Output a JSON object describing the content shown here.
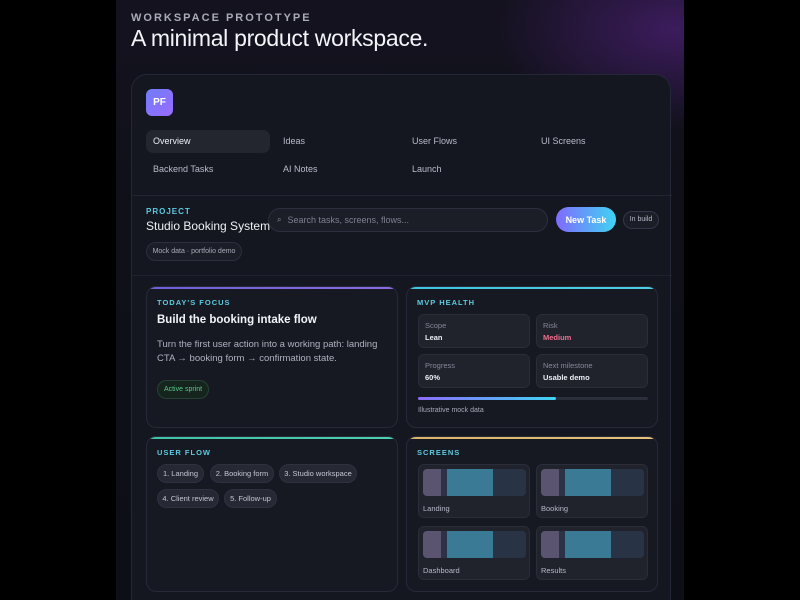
{
  "header": {
    "eyebrow": "WORKSPACE PROTOTYPE",
    "title": "A minimal product workspace."
  },
  "logo": {
    "initials": "PF"
  },
  "nav": {
    "items": [
      {
        "label": "Overview",
        "active": true
      },
      {
        "label": "Ideas"
      },
      {
        "label": "User Flows"
      },
      {
        "label": "UI Screens"
      },
      {
        "label": "Backend Tasks"
      },
      {
        "label": "AI Notes"
      },
      {
        "label": "Launch"
      }
    ]
  },
  "project": {
    "label": "PROJECT",
    "name": "Studio Booking System",
    "mock_chip": "Mock data · portfolio demo",
    "status_badge": "In build"
  },
  "search": {
    "placeholder": "Search tasks, screens, flows..."
  },
  "toolbar": {
    "new_task_label": "New Task"
  },
  "focus": {
    "label": "TODAY'S FOCUS",
    "title": "Build the booking intake flow",
    "description": "Turn the first user action into a working path: landing CTA → booking form → confirmation state.",
    "chip": "Active sprint"
  },
  "health": {
    "label": "MVP HEALTH",
    "metrics": [
      {
        "label": "Scope",
        "value": "Lean"
      },
      {
        "label": "Risk",
        "value": "Medium"
      },
      {
        "label": "Progress",
        "value": "60%"
      },
      {
        "label": "Next milestone",
        "value": "Usable demo"
      }
    ],
    "progress_fraction": 0.6,
    "note": "Illustrative mock data"
  },
  "flow": {
    "label": "USER FLOW",
    "steps": [
      "1. Landing",
      "2. Booking form",
      "3. Studio workspace",
      "4. Client review",
      "5. Follow-up"
    ]
  },
  "screens": {
    "label": "SCREENS",
    "items": [
      "Landing",
      "Booking",
      "Dashboard",
      "Results"
    ]
  },
  "colors": {
    "accent_cyan": "#5ccbdf",
    "accent_purple": "#8d6bff",
    "risk": "#f07090",
    "success": "#57c98a"
  }
}
